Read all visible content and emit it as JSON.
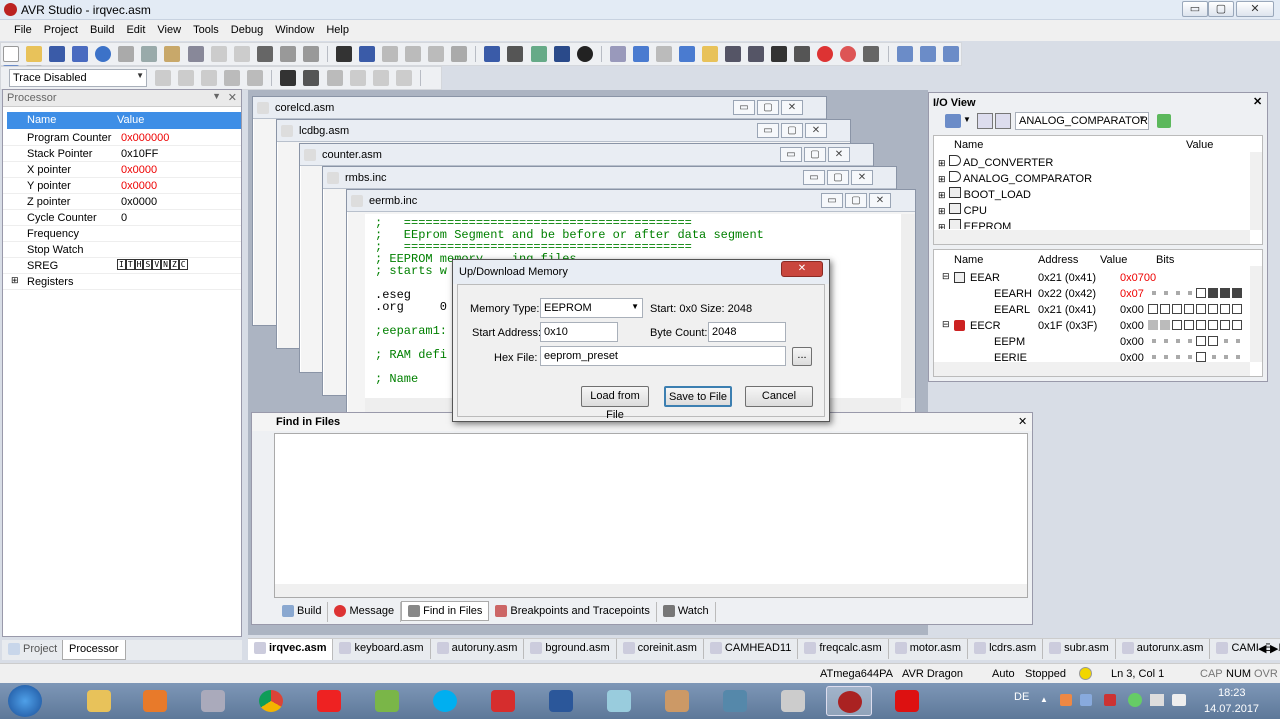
{
  "window": {
    "title": "AVR Studio - irqvec.asm",
    "min": "▭",
    "max": "▢",
    "close": "✕"
  },
  "menu": [
    "File",
    "Project",
    "Build",
    "Edit",
    "View",
    "Tools",
    "Debug",
    "Window",
    "Help"
  ],
  "trace_combo": {
    "value": "Trace Disabled"
  },
  "processor": {
    "title": "Processor",
    "headers": {
      "name": "Name",
      "value": "Value"
    },
    "rows": [
      {
        "name": "Program Counter",
        "value": "0x000000",
        "changed": true
      },
      {
        "name": "Stack Pointer",
        "value": "0x10FF",
        "changed": false
      },
      {
        "name": "X pointer",
        "value": "0x0000",
        "changed": true
      },
      {
        "name": "Y pointer",
        "value": "0x0000",
        "changed": true
      },
      {
        "name": "Z pointer",
        "value": "0x0000",
        "changed": false
      },
      {
        "name": "Cycle Counter",
        "value": "0",
        "changed": false
      },
      {
        "name": "Frequency",
        "value": "",
        "changed": false
      },
      {
        "name": "Stop Watch",
        "value": "",
        "changed": false
      },
      {
        "name": "SREG",
        "value": "",
        "changed": false
      },
      {
        "name": "Registers",
        "value": "",
        "changed": false
      }
    ],
    "sreg_bits": [
      "I",
      "T",
      "H",
      "S",
      "V",
      "N",
      "Z",
      "C"
    ],
    "tabs": [
      "Project",
      "Processor"
    ]
  },
  "docs": [
    {
      "name": "corelcd.asm"
    },
    {
      "name": "lcdbg.asm"
    },
    {
      "name": "counter.asm"
    },
    {
      "name": "rmbs.inc"
    },
    {
      "name": "eermb.inc"
    }
  ],
  "code_lines": [
    ";   ========================================",
    ";   EEprom Segment and be before or after data segment",
    ";   ========================================",
    "; EEPROM memory    ing files",
    "; starts w",
    "",
    ".eseg",
    ".org     0",
    "",
    ";eeparam1:                                           mory remc",
    "",
    "; RAM defi",
    "",
    "; Name                                               11"
  ],
  "dialog": {
    "title": "Up/Download Memory",
    "close": "✕",
    "memory_type_label": "Memory Type:",
    "memory_type_value": "EEPROM",
    "start_size": "Start: 0x0 Size: 2048",
    "start_address_label": "Start Address:",
    "start_address_value": "0x10",
    "byte_count_label": "Byte Count:",
    "byte_count_value": "2048",
    "hex_file_label": "Hex File:",
    "hex_file_value": "eeprom_preset",
    "browse": "...",
    "load_button": "Load from File",
    "save_button": "Save to File",
    "cancel_button": "Cancel"
  },
  "find_in_files": {
    "title": "Find in Files",
    "close": "✕",
    "tabs": [
      "Build",
      "Message",
      "Find in Files",
      "Breakpoints and Tracepoints",
      "Watch"
    ]
  },
  "io_view": {
    "title": "I/O View",
    "combo": "ANALOG_COMPARATOR",
    "tree_headers": {
      "name": "Name",
      "value": "Value"
    },
    "tree": [
      "AD_CONVERTER",
      "ANALOG_COMPARATOR",
      "BOOT_LOAD",
      "CPU",
      "EEPROM"
    ],
    "reg_headers": {
      "name": "Name",
      "address": "Address",
      "value": "Value",
      "bits": "Bits"
    },
    "regs": [
      {
        "name": "EEAR",
        "address": "0x21 (0x41)",
        "value": "0x0700",
        "bits": ""
      },
      {
        "name": "EEARH",
        "address": "0x22 (0x42)",
        "value": "0x07",
        "bits": "....#FFF"
      },
      {
        "name": "EEARL",
        "address": "0x21 (0x41)",
        "value": "0x00",
        "bits": "########"
      },
      {
        "name": "EECR",
        "address": "0x1F (0x3F)",
        "value": "0x00",
        "bits": "gg######"
      },
      {
        "name": "EEPM",
        "address": "",
        "value": "0x00",
        "bits": "....##.."
      },
      {
        "name": "EERIE",
        "address": "",
        "value": "0x00",
        "bits": "....#..."
      }
    ]
  },
  "file_tabs": [
    "irqvec.asm",
    "keyboard.asm",
    "autoruny.asm",
    "bground.asm",
    "coreinit.asm",
    "CAMHEAD11",
    "freqcalc.asm",
    "motor.asm",
    "lcdrs.asm",
    "subr.asm",
    "autorunx.asm",
    "CAMHEAD"
  ],
  "status": {
    "device": "ATmega644PA",
    "tool": "AVR Dragon",
    "mode": "Auto",
    "state": "Stopped",
    "position": "Ln 3, Col 1",
    "cap": "CAP",
    "num": "NUM",
    "ovr": "OVR"
  },
  "taskbar": {
    "lang": "DE",
    "time": "18:23",
    "date": "14.07.2017"
  }
}
